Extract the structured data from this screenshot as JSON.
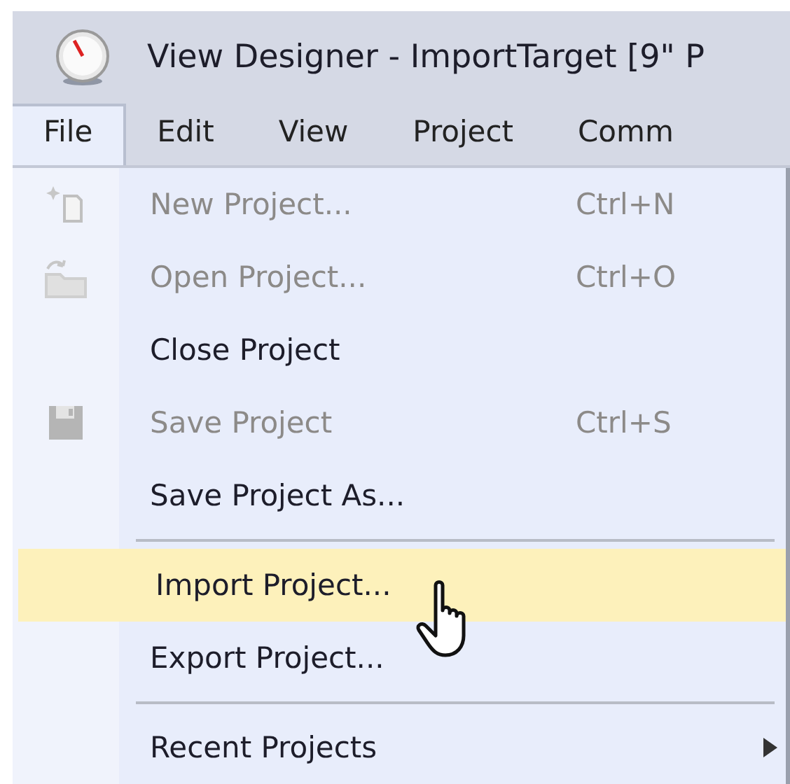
{
  "window": {
    "title": "View Designer - ImportTarget [9\" P"
  },
  "menu_bar": [
    {
      "label": "File",
      "selected": true
    },
    {
      "label": "Edit",
      "selected": false
    },
    {
      "label": "View",
      "selected": false
    },
    {
      "label": "Project",
      "selected": false
    },
    {
      "label": "Comm",
      "selected": false
    }
  ],
  "file_menu": [
    {
      "kind": "document",
      "label": "New Project...",
      "shortcut": "Ctrl+N",
      "disabled": true,
      "highlighted": false
    },
    {
      "kind": "folder",
      "label": "Open Project...",
      "shortcut": "Ctrl+O",
      "disabled": true,
      "highlighted": false
    },
    {
      "kind": "item",
      "label": "Close Project",
      "disabled": false,
      "highlighted": false
    },
    {
      "kind": "disk",
      "label": "Save Project",
      "shortcut": "Ctrl+S",
      "disabled": true,
      "highlighted": false
    },
    {
      "kind": "item",
      "label": "Save Project As...",
      "disabled": false,
      "highlighted": false
    },
    {
      "kind": "separator"
    },
    {
      "kind": "item",
      "label": "Import Project...",
      "disabled": false,
      "highlighted": true
    },
    {
      "kind": "item",
      "label": "Export Project...",
      "disabled": false,
      "highlighted": false
    },
    {
      "kind": "separator"
    },
    {
      "kind": "submenu",
      "label": "Recent Projects",
      "disabled": false,
      "highlighted": false
    }
  ]
}
